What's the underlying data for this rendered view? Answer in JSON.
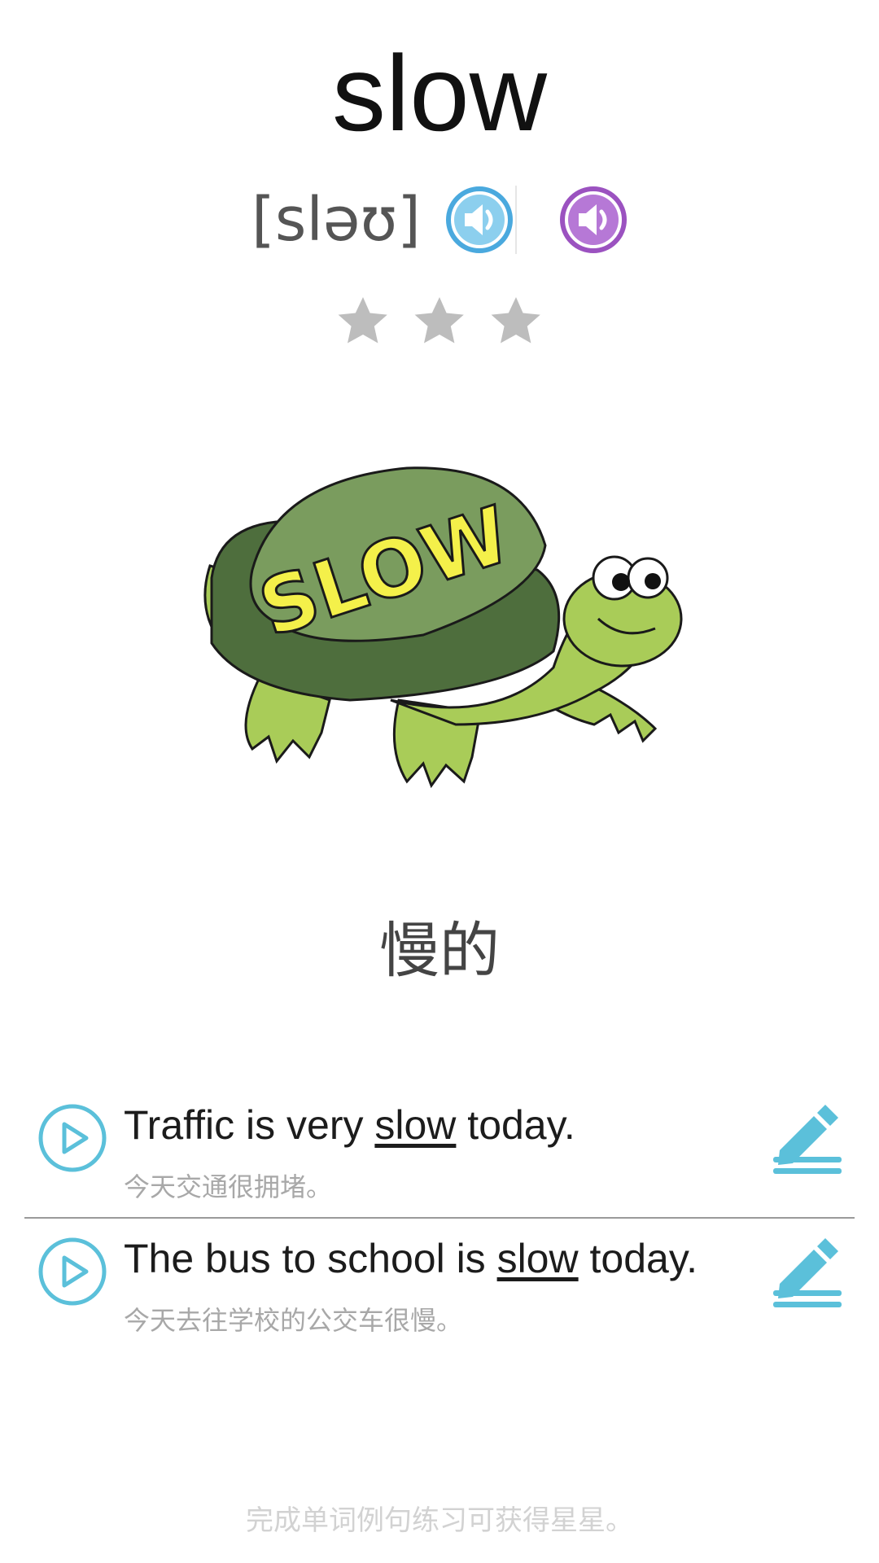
{
  "word": "slow",
  "phonetic": "[sləʊ]",
  "icons": {
    "uk_audio": "speaker-icon",
    "us_audio": "speaker-icon",
    "star": "star-icon",
    "play": "play-icon",
    "edit": "pencil-icon"
  },
  "colors": {
    "uk_audio": "#4aa9de",
    "us_audio": "#9b52c0",
    "star_empty": "#bdbdbd",
    "accent": "#5bc0da"
  },
  "stars": {
    "earned": 0,
    "total": 3
  },
  "image": {
    "shell_text": "SLOW"
  },
  "meaning": "慢的",
  "sentences": [
    {
      "before": "Traffic is very ",
      "highlight": "slow",
      "after": " today.",
      "translation": "今天交通很拥堵。"
    },
    {
      "before": "The bus to school is ",
      "highlight": "slow",
      "after": " today.",
      "translation": "今天去往学校的公交车很慢。"
    }
  ],
  "footer": "完成单词例句练习可获得星星。"
}
